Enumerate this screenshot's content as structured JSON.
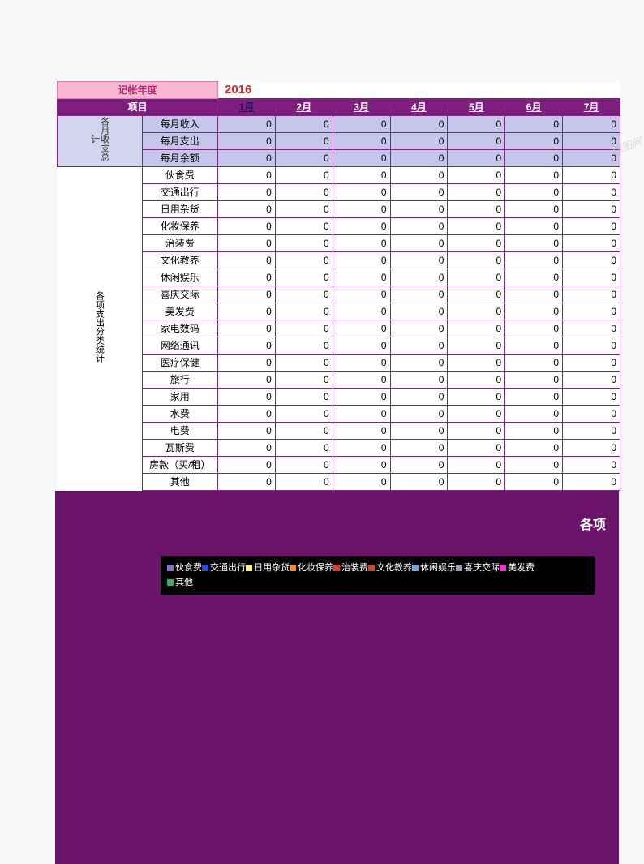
{
  "yearLabel": "记帐年度",
  "yearValue": "2016",
  "itemHeader": "项目",
  "months": [
    "1月",
    "2月",
    "3月",
    "4月",
    "5月",
    "6月",
    "7月"
  ],
  "summarySide": "各月收支总计",
  "summaryRows": [
    "每月收入",
    "每月支出",
    "每月余额"
  ],
  "categorySide": "各项支出分类统计",
  "categoryRows": [
    "伙食费",
    "交通出行",
    "日用杂货",
    "化妆保养",
    "治装费",
    "文化教养",
    "休闲娱乐",
    "喜庆交际",
    "美发费",
    "家电数码",
    "网络通讯",
    "医疗保健",
    "旅行",
    "家用",
    "水费",
    "电费",
    "瓦斯费",
    "房款（买/租）",
    "其他"
  ],
  "zero": "0",
  "chartTitle": "各项",
  "watermark": "新图网",
  "legend": [
    {
      "label": "伙食费",
      "color": "#8a6fc7"
    },
    {
      "label": "交通出行",
      "color": "#2b4cd6"
    },
    {
      "label": "日用杂货",
      "color": "#f2f26f"
    },
    {
      "label": "化妆保养",
      "color": "#f08f2e"
    },
    {
      "label": "治装费",
      "color": "#e63333"
    },
    {
      "label": "文化教养",
      "color": "#c44b2b"
    },
    {
      "label": "休闲娱乐",
      "color": "#7aa3d8"
    },
    {
      "label": "喜庆交际",
      "color": "#9aa2ae"
    },
    {
      "label": "美发费",
      "color": "#e835d6"
    },
    {
      "label": "其他",
      "color": "#3da85f"
    }
  ]
}
